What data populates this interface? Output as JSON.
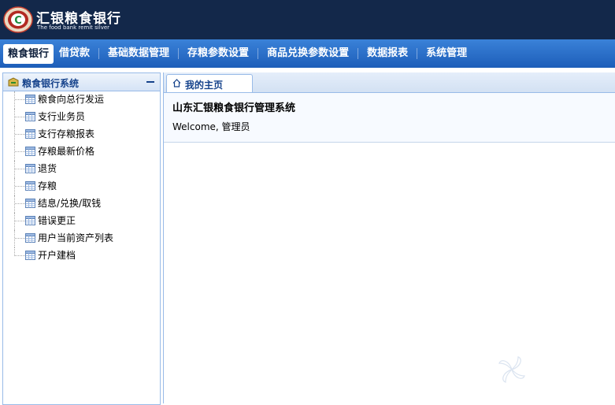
{
  "brand": {
    "title": "汇银粮食银行",
    "subtitle": "The food bank remit silver",
    "logo_text": "C"
  },
  "nav": {
    "items": [
      {
        "label": "粮食银行",
        "active": true
      },
      {
        "label": "借贷款"
      },
      {
        "label": "基础数据管理"
      },
      {
        "label": "存粮参数设置"
      },
      {
        "label": "商品兑换参数设置"
      },
      {
        "label": "数据报表"
      },
      {
        "label": "系统管理"
      }
    ]
  },
  "sidebar": {
    "title": "粮食银行系统",
    "items": [
      {
        "label": "粮食向总行发运"
      },
      {
        "label": "支行业务员"
      },
      {
        "label": "支行存粮报表"
      },
      {
        "label": "存粮最新价格"
      },
      {
        "label": "退货"
      },
      {
        "label": "存粮"
      },
      {
        "label": "结息/兑换/取钱"
      },
      {
        "label": "错误更正"
      },
      {
        "label": "用户当前资产列表"
      },
      {
        "label": "开户建档"
      }
    ]
  },
  "tabs": {
    "home_label": "我的主页"
  },
  "main": {
    "system_title": "山东汇银粮食银行管理系统",
    "welcome": "Welcome, 管理员"
  },
  "colors": {
    "banner": "#13284a",
    "nav": "#1d5eb9",
    "panel_border": "#99bbe8",
    "header_text": "#15428b"
  },
  "icons": {
    "panel": "grain-bag-icon",
    "tree_item": "table-icon",
    "tab": "home-icon",
    "collapse": "minus-icon"
  }
}
